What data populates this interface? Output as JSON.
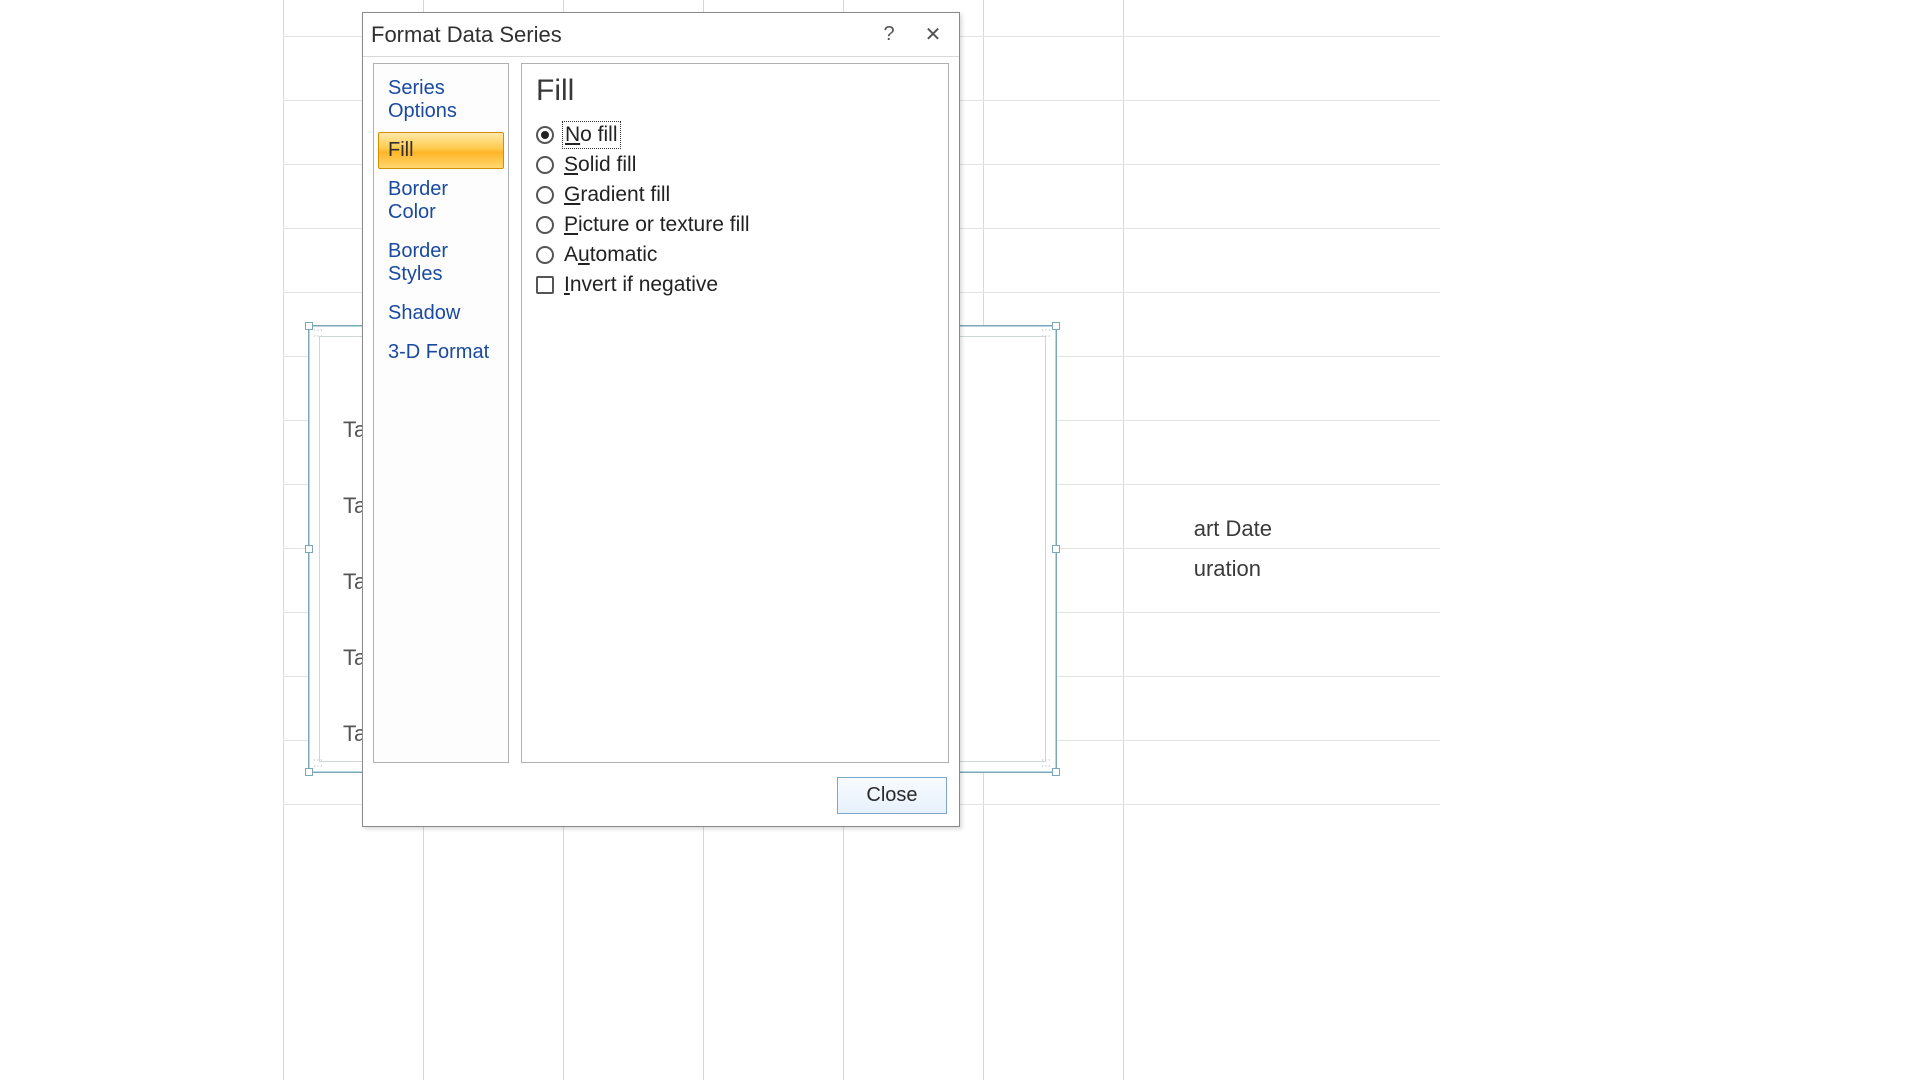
{
  "dialog": {
    "title": "Format Data Series",
    "help_tooltip": "Help",
    "close_tooltip": "Close",
    "close_button": "Close"
  },
  "nav": {
    "items": [
      {
        "label": "Series Options",
        "selected": false
      },
      {
        "label": "Fill",
        "selected": true
      },
      {
        "label": "Border Color",
        "selected": false
      },
      {
        "label": "Border Styles",
        "selected": false
      },
      {
        "label": "Shadow",
        "selected": false
      },
      {
        "label": "3-D Format",
        "selected": false
      }
    ]
  },
  "panel": {
    "title": "Fill",
    "options": {
      "no_fill": {
        "pre": "",
        "accel": "N",
        "post": "o fill",
        "checked": true
      },
      "solid": {
        "pre": "",
        "accel": "S",
        "post": "olid fill",
        "checked": false
      },
      "gradient": {
        "pre": "",
        "accel": "G",
        "post": "radient fill",
        "checked": false
      },
      "picture": {
        "pre": "",
        "accel": "P",
        "post": "icture or texture fill",
        "checked": false
      },
      "automatic": {
        "pre": "A",
        "accel": "u",
        "post": "tomatic",
        "checked": false
      }
    },
    "invert_negative": {
      "pre": "",
      "accel": "I",
      "post": "nvert if negative",
      "checked": false
    }
  },
  "background_chart": {
    "task_labels": [
      "Tasl",
      "Tasl",
      "Tasl",
      "Tasl",
      "Tasl"
    ],
    "legend": [
      "art Date",
      "uration"
    ]
  }
}
